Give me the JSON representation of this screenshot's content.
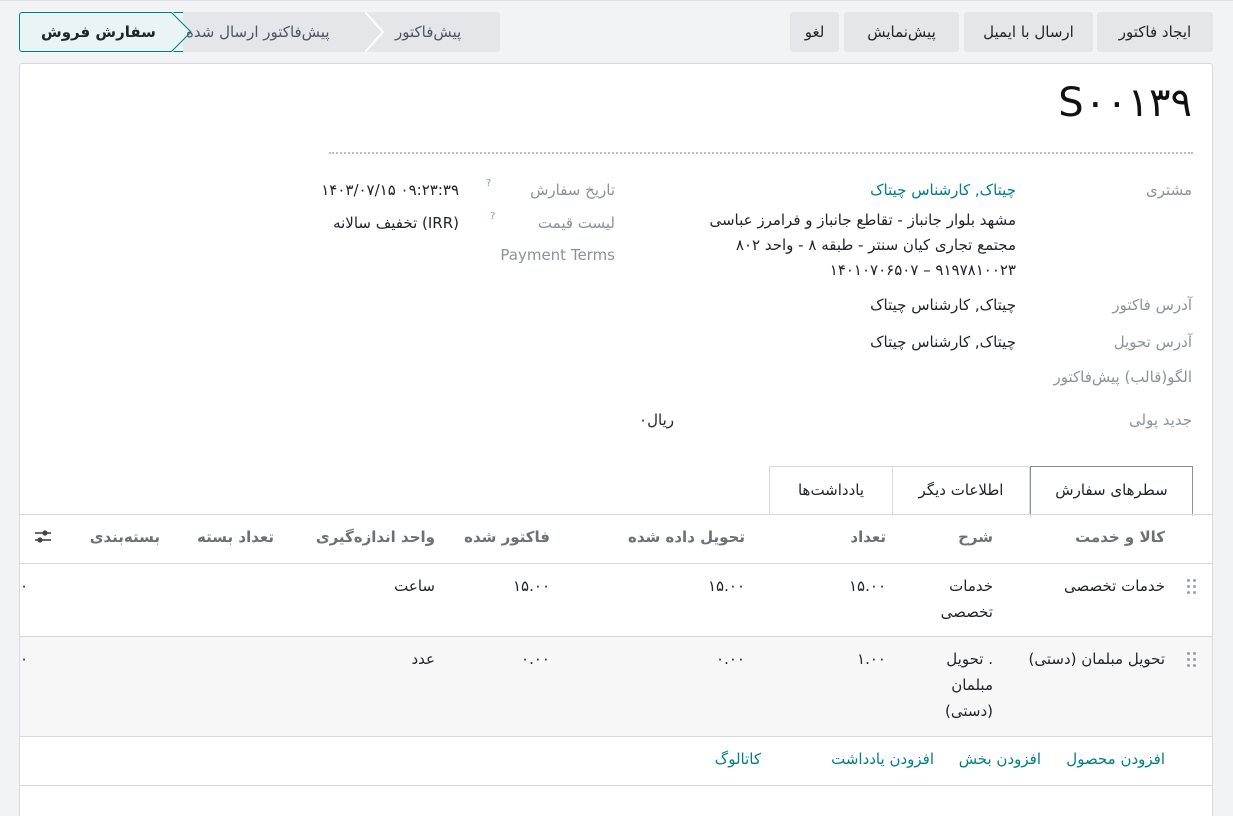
{
  "actions": {
    "create_invoice": "ایجاد فاکتور",
    "send_email": "ارسال با ایمیل",
    "preview": "پیش‌نمایش",
    "cancel": "لغو"
  },
  "statusbar": {
    "steps": [
      "سفارش فروش",
      "پیش‌فاکتور ارسال شده",
      "پیش‌فاکتور"
    ],
    "active": "سفارش فروش"
  },
  "record": {
    "title": "S۰۰۱۳۹",
    "customer_label": "مشتری",
    "customer_name": "چیتاک, کارشناس چیتاک",
    "customer_address_1": "مشهد بلوار جانباز - تقاطع جانباز و فرامرز عباسی",
    "customer_address_2": "مجتمع تجاری کیان سنتر - طبقه ۸ - واحد ۸۰۲",
    "customer_phones": "۱۴۰۱۰۷۰۶۵۰۷ – ۹۱۹۷۸۱۰۰۲۳",
    "invoice_address_label": "آدرس فاکتور",
    "invoice_address": "چیتاک, کارشناس چیتاک",
    "delivery_address_label": "آدرس تحویل",
    "delivery_address": "چیتاک, کارشناس چیتاک",
    "template_label": "الگو(قالب) پیش‌فاکتور",
    "currency_label": "جدید پولی",
    "currency_value": "۰ریال",
    "order_date_label": "تاریخ سفارش",
    "order_date": "۱۴۰۳/۰۷/۱۵ ۰۹:۲۳:۳۹",
    "pricelist_label": "لیست قیمت",
    "pricelist": "تخفیف سالانه (IRR)",
    "payment_terms_label": "Payment Terms",
    "help_mark": "?"
  },
  "tabs": [
    "سطرهای سفارش",
    "اطلاعات دیگر",
    "یادداشت‌ها"
  ],
  "table": {
    "headers": [
      "کالا و خدمت",
      "شرح",
      "تعداد",
      "تحویل داده شده",
      "فاکتور شده",
      "واحد اندازه‌گیری",
      "تعداد بسته",
      "بسته‌بندی"
    ],
    "rows": [
      {
        "product": "خدمات تخصصی",
        "desc_1": "خدمات",
        "desc_2": "تخصصی",
        "desc_3": "",
        "qty": "۱۵.۰۰",
        "delivered": "۱۵.۰۰",
        "invoiced": "۱۵.۰۰",
        "uom": "ساعت",
        "edge": "۰"
      },
      {
        "product": "تحویل مبلمان (دستی)",
        "desc_1": "تحویل .",
        "desc_2": "مبلمان",
        "desc_3": "(دستی)",
        "qty": "۱.۰۰",
        "delivered": "۰.۰۰",
        "invoiced": "۰.۰۰",
        "uom": "عدد",
        "edge": "۰"
      }
    ]
  },
  "add_links": {
    "product": "افزودن محصول",
    "section": "افزودن بخش",
    "note": "افزودن یادداشت",
    "catalog": "کاتالوگ"
  }
}
